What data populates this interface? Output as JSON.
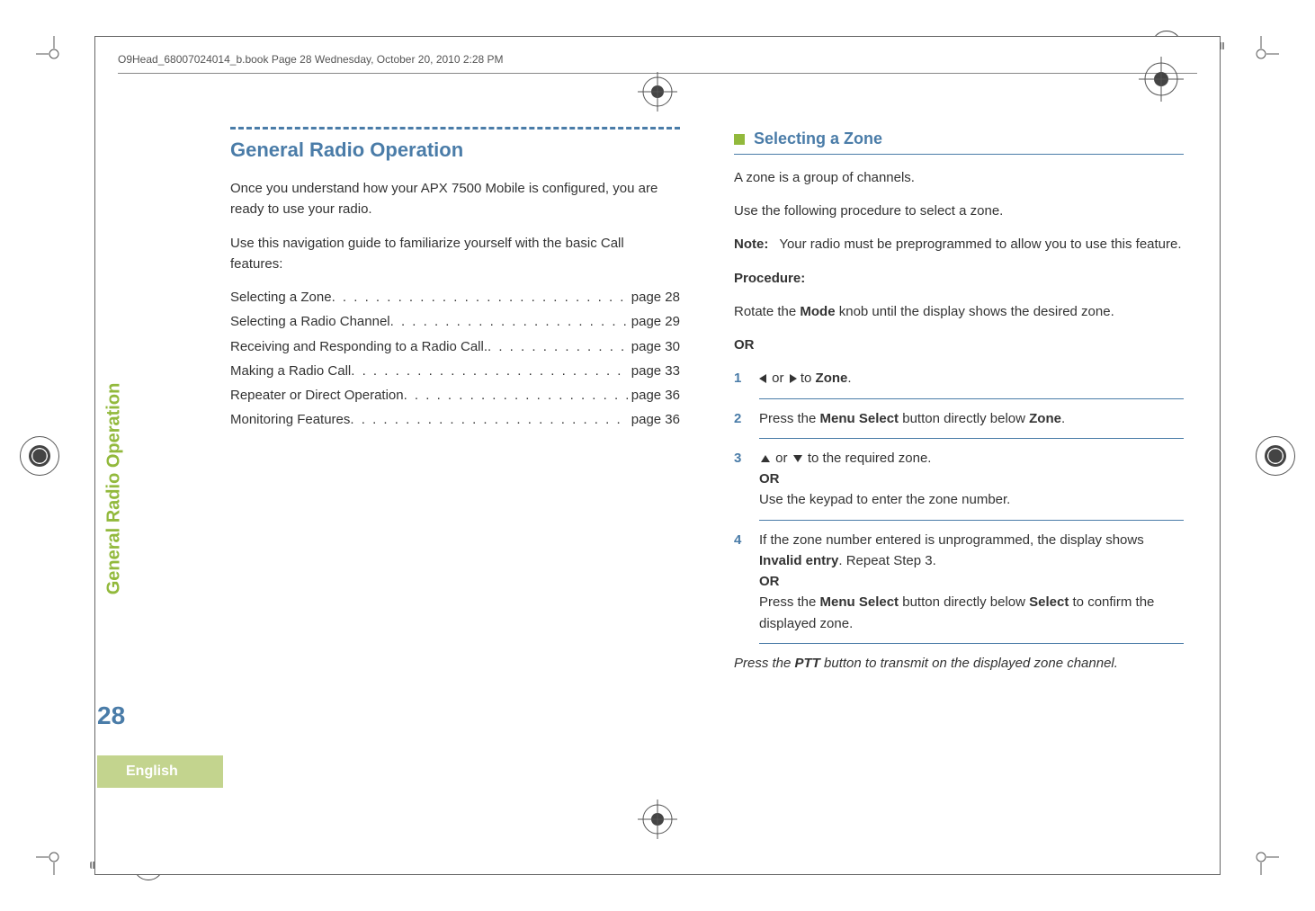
{
  "header": {
    "running": "O9Head_68007024014_b.book  Page 28  Wednesday, October 20, 2010  2:28 PM"
  },
  "left": {
    "title": "General Radio Operation",
    "intro1": "Once you understand how your APX 7500 Mobile is configured, you are ready to use your radio.",
    "intro2": "Use this navigation guide to familiarize yourself with the basic Call features:",
    "toc": [
      {
        "label": "Selecting a Zone",
        "page": "page 28"
      },
      {
        "label": "Selecting a Radio Channel",
        "page": "page 29"
      },
      {
        "label": "Receiving and Responding to a Radio Call.",
        "page": "page 30"
      },
      {
        "label": "Making a Radio Call",
        "page": "page 33"
      },
      {
        "label": "Repeater or Direct Operation",
        "page": "page 36"
      },
      {
        "label": "Monitoring Features",
        "page": "page 36"
      }
    ]
  },
  "right": {
    "h2": "Selecting a Zone",
    "p1": "A zone is a group of channels.",
    "p2": "Use the following procedure to select a zone.",
    "note_label": "Note:",
    "note_body": "Your radio must be preprogrammed to allow you to use this feature.",
    "procedure_label": "Procedure:",
    "p3a": "Rotate the ",
    "p3b": "Mode",
    "p3c": " knob until the display shows the desired zone.",
    "or_label": "OR",
    "steps": {
      "s1_num": "1",
      "s1_mid": " or ",
      "s1_to": " to ",
      "s1_zone": "Zone",
      "s1_end": ".",
      "s2_num": "2",
      "s2_a": "Press the ",
      "s2_b": "Menu Select",
      "s2_c": " button directly below ",
      "s2_zone": "Zone",
      "s2_end": ".",
      "s3_num": "3",
      "s3_mid": " or ",
      "s3_end": " to the required zone.",
      "s3_or": "OR",
      "s3_alt": "Use the keypad to enter the zone number.",
      "s4_num": "4",
      "s4_a": "If the zone number entered is unprogrammed, the display shows ",
      "s4_inv": "Invalid entry",
      "s4_b": ". Repeat Step 3.",
      "s4_or": "OR",
      "s4_c": "Press the ",
      "s4_d": "Menu Select",
      "s4_e": " button directly below ",
      "s4_sel": "Select",
      "s4_f": " to confirm the displayed zone."
    },
    "closing_a": "Press the ",
    "closing_ptt": "PTT",
    "closing_b": " button to transmit on the displayed zone channel."
  },
  "side": {
    "tab": "General Radio Operation",
    "page_number": "28",
    "language": "English"
  }
}
